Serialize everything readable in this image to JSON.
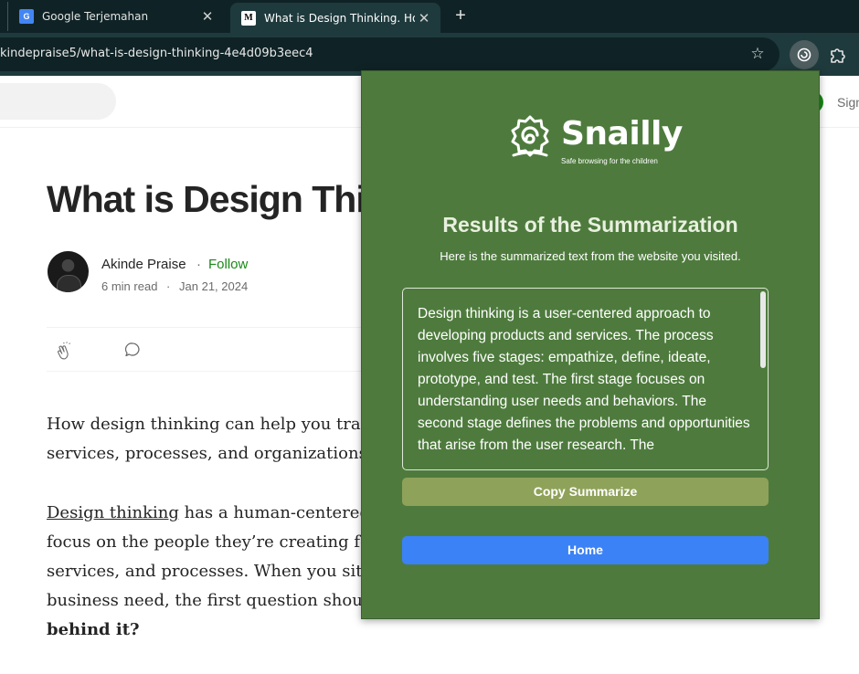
{
  "browser": {
    "tabs": [
      {
        "title": "Google Terjemahan",
        "favicon": "google-translate-icon",
        "active": false
      },
      {
        "title": "What is Design Thinking. How d",
        "favicon": "medium-icon",
        "active": true
      }
    ],
    "url": "kindepraise5/what-is-design-thinking-4e4d09b3eec4",
    "close_glyph": "✕",
    "new_tab_glyph": "+"
  },
  "medium": {
    "sign_in_partial": "Sign",
    "article": {
      "title": "What is Design Thi",
      "author": "Akinde Praise",
      "separator": "·",
      "follow": "Follow",
      "read_time": "6 min read",
      "meta_dot": "·",
      "date": "Jan 21, 2024",
      "para1_line1": "How design thinking can help you tran",
      "para1_line2": "services, processes, and organizations.",
      "para2_link": "Design thinking",
      "para2_line1_rest": " has a human-centered",
      "para2_line2": "focus on the people they’re creating for",
      "para2_line3": "services, and processes. When you sit d",
      "para2_line4": "business need, the first question should",
      "para2_line5": "behind it?"
    }
  },
  "popup": {
    "brand": "Snailly",
    "tagline": "Safe browsing for the children",
    "heading": "Results of the Summarization",
    "subheading": "Here is the summarized text from the website you visited.",
    "summary": "Design thinking is a user-centered approach to developing products and services. The process involves five stages: empathize, define, ideate, prototype, and test. The first stage focuses on understanding user needs and behaviors. The second stage defines the problems and opportunities that arise from the user research. The",
    "copy_button": "Copy Summarize",
    "home_button": "Home",
    "colors": {
      "background": "#4e7b3d",
      "copy_button": "#8fa25a",
      "home_button": "#3b82f6"
    }
  }
}
